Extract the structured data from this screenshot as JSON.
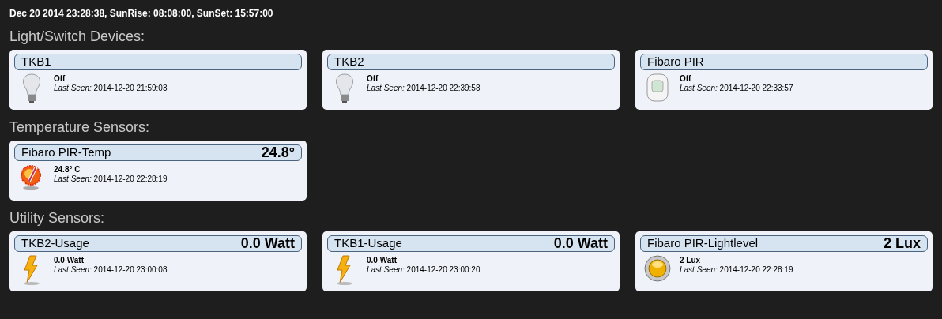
{
  "status_line": "Dec 20 2014 23:28:38, SunRise: 08:08:00, SunSet: 15:57:00",
  "sections": [
    {
      "title": "Light/Switch Devices:",
      "devices": [
        {
          "name": "TKB1",
          "kind": "bulb",
          "status": "Off",
          "last_seen": "*Last Seen:* 2014-12-20 21:59:03"
        },
        {
          "name": "TKB2",
          "kind": "bulb",
          "status": "Off",
          "last_seen": "*Last Seen:* 2014-12-20 22:39:58"
        },
        {
          "name": "Fibaro PIR",
          "kind": "pir",
          "status": "Off",
          "last_seen": "*Last Seen:* 2014-12-20 22:33:57"
        }
      ]
    },
    {
      "title": "Temperature Sensors:",
      "devices": [
        {
          "name": "Fibaro PIR-Temp",
          "value": "24.8°",
          "kind": "thermo",
          "status": "24.8° C",
          "last_seen": "*Last Seen:* 2014-12-20 22:28:19"
        }
      ]
    },
    {
      "title": "Utility Sensors:",
      "devices": [
        {
          "name": "TKB2-Usage",
          "value": "0.0 Watt",
          "kind": "bolt",
          "status": "0.0 Watt",
          "last_seen": "*Last Seen:* 2014-12-20 23:00:08"
        },
        {
          "name": "TKB1-Usage",
          "value": "0.0 Watt",
          "kind": "bolt",
          "status": "0.0 Watt",
          "last_seen": "*Last Seen:* 2014-12-20 23:00:20"
        },
        {
          "name": "Fibaro PIR-Lightlevel",
          "value": "2 Lux",
          "kind": "lux",
          "status": "2 Lux",
          "last_seen": "*Last Seen:* 2014-12-20 22:28:19"
        }
      ]
    }
  ]
}
